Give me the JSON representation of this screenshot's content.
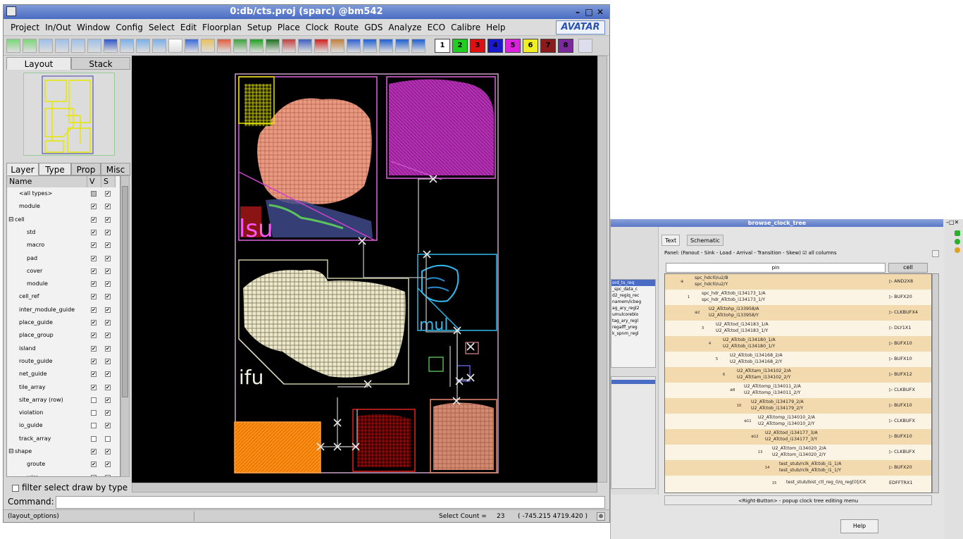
{
  "main_window": {
    "title": "0:db/cts.proj (sparc) @bm542",
    "menu": [
      "Project",
      "In/Out",
      "Window",
      "Config",
      "Select",
      "Edit",
      "Floorplan",
      "Setup",
      "Place",
      "Clock",
      "Route",
      "GDS",
      "Analyze",
      "ECO",
      "Calibre",
      "Help"
    ],
    "logo": "AVATAR",
    "color_swatches": [
      {
        "label": "1",
        "color": "#ffffff"
      },
      {
        "label": "2",
        "color": "#22cc22"
      },
      {
        "label": "3",
        "color": "#dd1111"
      },
      {
        "label": "4",
        "color": "#1a1acc"
      },
      {
        "label": "5",
        "color": "#dd22dd"
      },
      {
        "label": "6",
        "color": "#eeee22"
      },
      {
        "label": "7",
        "color": "#8b1a1a"
      },
      {
        "label": "8",
        "color": "#7a2a9a"
      }
    ]
  },
  "left_panel": {
    "top_tabs": [
      "Layout",
      "Stack"
    ],
    "sub_tabs": [
      "Layer",
      "Type",
      "Prop",
      "Misc"
    ],
    "columns": {
      "name": "Name",
      "v": "V",
      "s": "S"
    },
    "rows": [
      {
        "name": "<all types>",
        "indent": 1,
        "v": "partial",
        "s": "on"
      },
      {
        "name": "module",
        "indent": 1,
        "v": "on",
        "s": "on"
      },
      {
        "name": "cell",
        "indent": 0,
        "expander": "⊟",
        "v": "on",
        "s": "on"
      },
      {
        "name": "std",
        "indent": 2,
        "v": "on",
        "s": "on"
      },
      {
        "name": "macro",
        "indent": 2,
        "v": "on",
        "s": "on"
      },
      {
        "name": "pad",
        "indent": 2,
        "v": "on",
        "s": "on"
      },
      {
        "name": "cover",
        "indent": 2,
        "v": "on",
        "s": "on"
      },
      {
        "name": "module",
        "indent": 2,
        "v": "on",
        "s": "on"
      },
      {
        "name": "cell_ref",
        "indent": 1,
        "v": "on",
        "s": "on"
      },
      {
        "name": "inter_module_guide",
        "indent": 1,
        "v": "on",
        "s": "on"
      },
      {
        "name": "place_guide",
        "indent": 1,
        "v": "on",
        "s": "on"
      },
      {
        "name": "place_group",
        "indent": 1,
        "v": "on",
        "s": "on"
      },
      {
        "name": "island",
        "indent": 1,
        "v": "on",
        "s": "on"
      },
      {
        "name": "route_guide",
        "indent": 1,
        "v": "on",
        "s": "on"
      },
      {
        "name": "net_guide",
        "indent": 1,
        "v": "on",
        "s": "on"
      },
      {
        "name": "tile_array",
        "indent": 1,
        "v": "on",
        "s": "on"
      },
      {
        "name": "site_array (row)",
        "indent": 1,
        "v": "off",
        "s": "on"
      },
      {
        "name": "violation",
        "indent": 1,
        "v": "off",
        "s": "on"
      },
      {
        "name": "io_guide",
        "indent": 1,
        "v": "off",
        "s": "on"
      },
      {
        "name": "track_array",
        "indent": 1,
        "v": "off",
        "s": "off"
      },
      {
        "name": "shape",
        "indent": 0,
        "expander": "⊟",
        "v": "on",
        "s": "on"
      },
      {
        "name": "groute",
        "indent": 2,
        "v": "on",
        "s": "on"
      },
      {
        "name": "wire",
        "indent": 2,
        "v": "off",
        "s": "off"
      }
    ],
    "filter_label": "filter select draw by type"
  },
  "layout": {
    "modules": [
      {
        "label": "lsu",
        "color": "#ff55ff"
      },
      {
        "label": "ifu",
        "color": "#f2f2e0"
      },
      {
        "label": "mul",
        "color": "#33bbee"
      }
    ]
  },
  "command": {
    "label": "Command:",
    "value": ""
  },
  "status": {
    "options": "(layout_options)",
    "select_count_label": "Select Count =",
    "select_count": "23",
    "coords": "( -745.215 4719.420 )"
  },
  "clock_tree": {
    "title": "browse_clock_tree",
    "left_items": [
      "ord_ts_req",
      "_spc_data_c",
      "d2_regiq_rec",
      "namem/icbeg",
      "ag_ary_regl2",
      "umulcoreblo",
      "tag_ary_regl",
      "regalff_yreg",
      "k_spnm_regl"
    ],
    "tabs": [
      "Text",
      "Schematic"
    ],
    "panel_row": "Panel: (Fanout - Sink - Load - Arrival - Transition - Skew)  ☑ all columns",
    "pin_header": "pin",
    "cell_header": "cell",
    "rows": [
      {
        "level": 0,
        "marker": "⊕",
        "a": "spc_hdcl0/u2/B",
        "b": "spc_hdcl0/u2/Y",
        "cell": "▷ AND2X8"
      },
      {
        "level": 1,
        "marker": "1",
        "a": "spc_hdr_ATctob_i134173_1/A",
        "b": "spc_hdr_ATctob_i134173_1/Y",
        "cell": "▷ BUFX20"
      },
      {
        "level": 2,
        "marker": "⊕2",
        "a": "U2_ATctohp_i133958/A",
        "b": "U2_ATctohp_i133958/Y",
        "cell": "▷ CLKBUFX4"
      },
      {
        "level": 3,
        "marker": "3",
        "a": "U2_ATctod_i134183_1/A",
        "b": "U2_ATctod_i134183_1/Y",
        "cell": "▷ DLY1X1"
      },
      {
        "level": 4,
        "marker": "4",
        "a": "U2_ATctob_i134180_1/A",
        "b": "U2_ATctob_i134180_1/Y",
        "cell": "▷ BUFX10"
      },
      {
        "level": 5,
        "marker": "5",
        "a": "U2_ATctob_i134168_2/A",
        "b": "U2_ATctob_i134168_2/Y",
        "cell": "▷ BUFX10"
      },
      {
        "level": 6,
        "marker": "6",
        "a": "U2_ATctam_i134102_2/A",
        "b": "U2_ATctam_i134102_2/Y",
        "cell": "▷ BUFX12"
      },
      {
        "level": 7,
        "marker": "⊕8",
        "a": "U2_ATctomp_i134011_2/A",
        "b": "U2_ATctomp_i134011_2/Y",
        "cell": "▷ CLKBUFX"
      },
      {
        "level": 8,
        "marker": "10",
        "a": "U2_ATctob_i134179_2/A",
        "b": "U2_ATctob_i134179_2/Y",
        "cell": "▷ BUFX10"
      },
      {
        "level": 9,
        "marker": "⊕11",
        "a": "U2_ATctomp_i134010_2/A",
        "b": "U2_ATctomp_i134010_2/Y",
        "cell": "▷ CLKBUFX"
      },
      {
        "level": 10,
        "marker": "⊕12",
        "a": "U2_ATctod_i134177_3/A",
        "b": "U2_ATctod_i134177_3/Y",
        "cell": "▷ BUFX10"
      },
      {
        "level": 11,
        "marker": "13",
        "a": "U2_ATctom_i134020_2/A",
        "b": "U2_ATctom_i134020_2/Y",
        "cell": "▷ CLKBUFX"
      },
      {
        "level": 12,
        "marker": "14",
        "a": "test_stub/rclk_ATctob_i1_1/A",
        "b": "test_stub/rclk_ATctob_i1_1/Y",
        "cell": "▷ BUFX20"
      },
      {
        "level": 13,
        "marker": "15",
        "a": "test_stub/bist_ctl_reg_0/q_reg[0]/CK",
        "b": "",
        "cell": "EDFFTRX1"
      }
    ],
    "hint": "<Right-Button> - popup clock tree editing menu",
    "help_button": "Help"
  }
}
